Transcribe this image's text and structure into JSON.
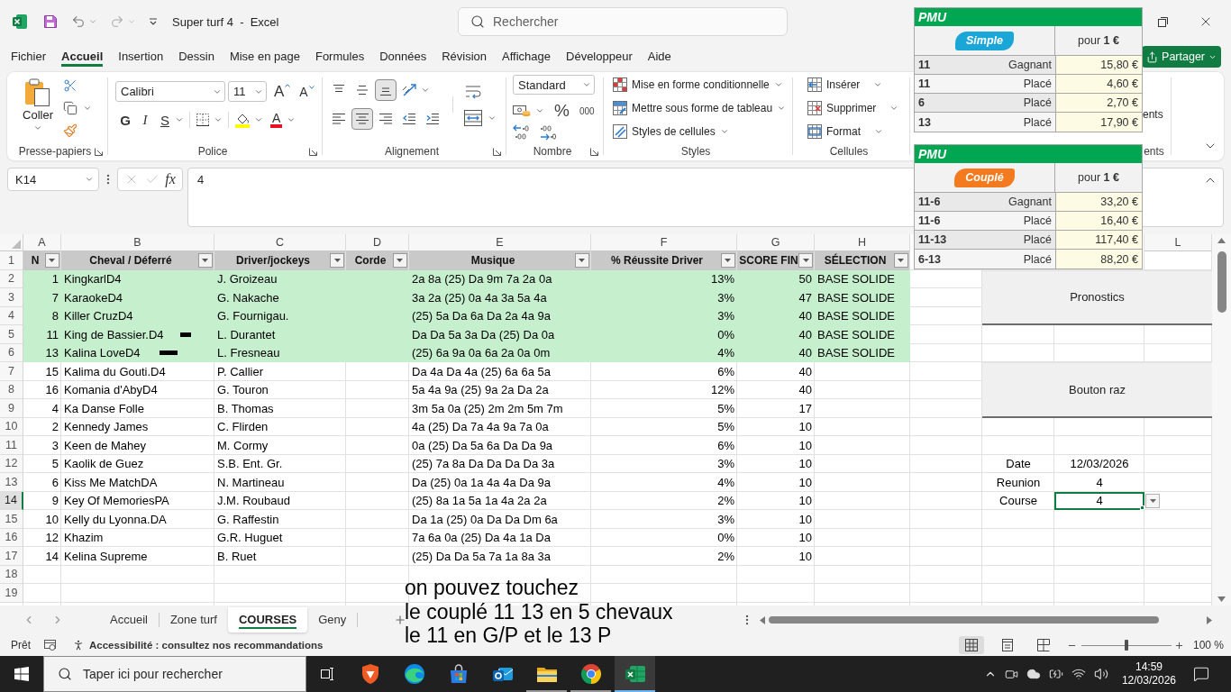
{
  "title_bar": {
    "title": "Super turf 4  -  Excel",
    "search": {
      "placeholder": "Rechercher"
    }
  },
  "menu_tabs": [
    {
      "label": "Fichier",
      "selected": false
    },
    {
      "label": "Accueil",
      "selected": true
    },
    {
      "label": "Insertion",
      "selected": false
    },
    {
      "label": "Dessin",
      "selected": false
    },
    {
      "label": "Mise en page",
      "selected": false
    },
    {
      "label": "Formules",
      "selected": false
    },
    {
      "label": "Données",
      "selected": false
    },
    {
      "label": "Révision",
      "selected": false
    },
    {
      "label": "Affichage",
      "selected": false
    },
    {
      "label": "Développeur",
      "selected": false
    },
    {
      "label": "Aide",
      "selected": false
    }
  ],
  "share_button": {
    "label": "Partager"
  },
  "ribbon": {
    "clipboard": {
      "paste": "Coller",
      "label": "Presse-papiers"
    },
    "font": {
      "name": "Calibri",
      "size": "11",
      "grow_button": "A",
      "shrink_button": "A",
      "bold_button": "G",
      "italic_button": "I",
      "underline_button": "S",
      "font_color_button": "A",
      "label": "Police"
    },
    "alignment": {
      "vertical": [
        {
          "kind": "top",
          "selected": false
        },
        {
          "kind": "middle",
          "selected": false
        },
        {
          "kind": "bottom",
          "selected": true
        }
      ],
      "horizontal": [
        {
          "kind": "left",
          "selected": false
        },
        {
          "kind": "center",
          "selected": true
        },
        {
          "kind": "right",
          "selected": false
        }
      ],
      "label": "Alignement"
    },
    "number": {
      "format": "Standard",
      "percent": "%",
      "thousands": "000",
      "label": "Nombre"
    },
    "styles": {
      "commands": [
        {
          "kind": "conditional",
          "label": "Mise en forme conditionnelle"
        },
        {
          "kind": "table",
          "label": "Mettre sous forme de tableau"
        },
        {
          "kind": "cell_styles",
          "label": "Styles de cellules"
        }
      ],
      "label": "Styles"
    },
    "cells": {
      "commands": [
        {
          "kind": "insert",
          "label": "Insérer"
        },
        {
          "kind": "delete",
          "label": "Supprimer"
        },
        {
          "kind": "format",
          "label": "Format"
        }
      ],
      "label": "Cellules"
    },
    "addins": {
      "command": "ents",
      "label": "ents"
    }
  },
  "formula_bar": {
    "name_box": "K14",
    "edit_disabled": true,
    "function_button": "fx",
    "formula": "4"
  },
  "sheet": {
    "column_letters": [
      "A",
      "B",
      "C",
      "D",
      "E",
      "F",
      "G",
      "H",
      "L"
    ],
    "row_numbers": [
      {
        "label": "1",
        "selected": false
      },
      {
        "label": "2",
        "selected": false
      },
      {
        "label": "3",
        "selected": false
      },
      {
        "label": "4",
        "selected": false
      },
      {
        "label": "5",
        "selected": false
      },
      {
        "label": "6",
        "selected": false
      },
      {
        "label": "7",
        "selected": false
      },
      {
        "label": "8",
        "selected": false
      },
      {
        "label": "9",
        "selected": false
      },
      {
        "label": "10",
        "selected": false
      },
      {
        "label": "11",
        "selected": false
      },
      {
        "label": "12",
        "selected": false
      },
      {
        "label": "13",
        "selected": false
      },
      {
        "label": "14",
        "selected": true
      },
      {
        "label": "15",
        "selected": false
      },
      {
        "label": "16",
        "selected": false
      },
      {
        "label": "17",
        "selected": false
      },
      {
        "label": "18",
        "selected": false
      },
      {
        "label": "19",
        "selected": false
      }
    ],
    "table": {
      "columns": [
        {
          "label": "N",
          "filter": true
        },
        {
          "label": "Cheval / Déferré",
          "filter": true
        },
        {
          "label": "Driver/jockeys",
          "filter": true
        },
        {
          "label": "Corde",
          "filter": true
        },
        {
          "label": "Musique",
          "filter": true
        },
        {
          "label": "% Réussite Driver",
          "filter": true
        },
        {
          "label": "SCORE FIN",
          "filter": true
        },
        {
          "label": "SÉLECTION",
          "filter": true
        }
      ],
      "rows": [
        {
          "kind": "plain",
          "number": "1",
          "horse": "KingkarlD4",
          "driver": "J. Groizeau",
          "music": "2a 8a (25) Da 9m 7a 2a 0a",
          "driver_success": "13%",
          "final_score": "50",
          "selection": "BASE SOLIDE",
          "highlighted": true
        },
        {
          "kind": "plain",
          "number": "7",
          "horse": "KaraokeD4",
          "driver": "G. Nakache",
          "music": "3a 2a (25) 0a 4a 3a 5a 4a",
          "driver_success": "3%",
          "final_score": "47",
          "selection": "BASE SOLIDE",
          "highlighted": true
        },
        {
          "kind": "plain",
          "number": "8",
          "horse": "Killer CruzD4",
          "driver": "G. Fournigau.",
          "music": "(25) 5a Da 6a Da 2a 4a 9a",
          "driver_success": "3%",
          "final_score": "40",
          "selection": "BASE SOLIDE",
          "highlighted": true
        },
        {
          "kind": "short_mark",
          "number": "11",
          "horse": "King de Bassier.D4",
          "driver": "L. Durantet",
          "music": "Da Da 5a 3a Da (25) Da 0a",
          "driver_success": "0%",
          "final_score": "40",
          "selection": "BASE SOLIDE",
          "highlighted": true
        },
        {
          "kind": "long_mark",
          "number": "13",
          "horse": "Kalina LoveD4",
          "driver": "L. Fresneau",
          "music": "(25) 6a 9a 0a 6a 2a 0a 0m",
          "driver_success": "4%",
          "final_score": "40",
          "selection": "BASE SOLIDE",
          "highlighted": true
        },
        {
          "kind": "plain",
          "number": "15",
          "horse": "Kalima du Gouti.D4",
          "driver": "P. Callier",
          "music": "Da 4a Da 4a (25) 6a 6a 5a",
          "driver_success": "6%",
          "final_score": "40",
          "highlighted": false
        },
        {
          "kind": "plain",
          "number": "16",
          "horse": "Komania d'AbyD4",
          "driver": "G. Touron",
          "music": "5a 4a 9a (25) 9a 2a Da 2a",
          "driver_success": "12%",
          "final_score": "40",
          "highlighted": false
        },
        {
          "kind": "plain",
          "number": "4",
          "horse": "Ka Danse Folle",
          "driver": "B. Thomas",
          "music": "3m 5a 0a (25) 2m 2m 5m 7m",
          "driver_success": "5%",
          "final_score": "17",
          "highlighted": false
        },
        {
          "kind": "plain",
          "number": "2",
          "horse": "Kennedy James",
          "driver": "C. Flirden",
          "music": "4a (25) Da 7a 4a 9a 7a 0a",
          "driver_success": "5%",
          "final_score": "10",
          "highlighted": false
        },
        {
          "kind": "plain",
          "number": "3",
          "horse": "Keen de Mahey",
          "driver": "M. Cormy",
          "music": "0a (25) Da 5a 6a Da Da 9a",
          "driver_success": "6%",
          "final_score": "10",
          "highlighted": false
        },
        {
          "kind": "plain",
          "number": "5",
          "horse": "Kaolik de Guez",
          "driver": "S.B. Ent. Gr.",
          "music": "(25) 7a 8a Da Da Da Da 3a",
          "driver_success": "3%",
          "final_score": "10",
          "highlighted": false
        },
        {
          "kind": "plain",
          "number": "6",
          "horse": "Kiss Me MatchDA",
          "driver": "N. Martineau",
          "music": "Da (25) 0a 1a 4a 4a Da 9a",
          "driver_success": "4%",
          "final_score": "10",
          "highlighted": false
        },
        {
          "kind": "plain",
          "number": "9",
          "horse": "Key Of MemoriesPA",
          "driver": "J.M. Roubaud",
          "music": "(25) 8a 1a 5a 1a 4a 2a 2a",
          "driver_success": "2%",
          "final_score": "10",
          "highlighted": false
        },
        {
          "kind": "plain",
          "number": "10",
          "horse": "Kelly du Lyonna.DA",
          "driver": "G. Raffestin",
          "music": "Da 1a (25) 0a Da Da Dm 6a",
          "driver_success": "3%",
          "final_score": "10",
          "highlighted": false
        },
        {
          "kind": "plain",
          "number": "12",
          "horse": "Khazim",
          "driver": "G.R. Huguet",
          "music": "7a 6a 0a (25) Da 4a 1a Da",
          "driver_success": "0%",
          "final_score": "10",
          "highlighted": false
        },
        {
          "kind": "plain",
          "number": "14",
          "horse": "Kelina Supreme",
          "driver": "B. Ruet",
          "music": "(25) Da Da 5a 7a 1a 8a 3a",
          "driver_success": "2%",
          "final_score": "10",
          "highlighted": false
        }
      ]
    },
    "side_cells": [
      {
        "label": "Date",
        "value": "12/03/2026",
        "selected": false
      },
      {
        "label": "Reunion",
        "value": "4",
        "selected": false
      },
      {
        "label": "Course",
        "value": "4",
        "selected": true
      }
    ],
    "buttons": [
      {
        "label": "Pronostics"
      },
      {
        "label": "Bouton raz"
      }
    ]
  },
  "pmu_cards": [
    {
      "brand": "PMU",
      "bet_type": "Simple",
      "color": "#1aa7d8",
      "stake": "pour **1 €**",
      "rows": [
        {
          "selection": "11",
          "result": "Gagnant",
          "payout": "15,80 €"
        },
        {
          "selection": "11",
          "result": "Placé",
          "payout": "4,60 €"
        },
        {
          "selection": "6",
          "result": "Placé",
          "payout": "2,70 €"
        },
        {
          "selection": "13",
          "result": "Placé",
          "payout": "17,90 €"
        }
      ]
    },
    {
      "brand": "PMU",
      "bet_type": "Couplé",
      "color": "#f47a20",
      "stake": "pour **1 €**",
      "rows": [
        {
          "selection": "11-6",
          "result": "Gagnant",
          "payout": "33,20 €"
        },
        {
          "selection": "11-6",
          "result": "Placé",
          "payout": "16,40 €"
        },
        {
          "selection": "11-13",
          "result": "Placé",
          "payout": "117,40 €"
        },
        {
          "selection": "6-13",
          "result": "Placé",
          "payout": "88,20 €"
        }
      ]
    }
  ],
  "note": {
    "lines": [
      "on pouvez touchez",
      "le couplé 11 13 en 5 chevaux",
      "le 11 en G/P et le 13 P"
    ]
  },
  "sheet_tabs": [
    {
      "label": "Accueil",
      "selected": false
    },
    {
      "label": "Zone turf",
      "selected": false
    },
    {
      "label": "COURSES",
      "selected": true
    },
    {
      "label": "Geny",
      "selected": false
    }
  ],
  "status_bar": {
    "mode": "Prêt",
    "accessibility": "Accessibilité : consultez nos recommandations",
    "views": [
      {
        "kind": "normal",
        "selected": true
      },
      {
        "kind": "page_layout",
        "selected": false
      },
      {
        "kind": "page_break",
        "selected": false
      }
    ],
    "zoom_slider": {
      "level": 0.5
    },
    "zoom": "100 %"
  },
  "taskbar": {
    "search": {
      "placeholder": "Taper ici pour rechercher"
    },
    "apps": [
      {
        "kind": "shield",
        "running": false,
        "selected": false
      },
      {
        "kind": "edge",
        "running": false,
        "selected": false
      },
      {
        "kind": "store",
        "running": false,
        "selected": false
      },
      {
        "kind": "mail",
        "running": false,
        "selected": false
      },
      {
        "kind": "folder",
        "running": true,
        "selected": false
      },
      {
        "kind": "chrome",
        "running": true,
        "selected": false
      },
      {
        "kind": "excel",
        "running": true,
        "selected": true
      }
    ],
    "time": "14:59",
    "date": "12/03/2026"
  }
}
